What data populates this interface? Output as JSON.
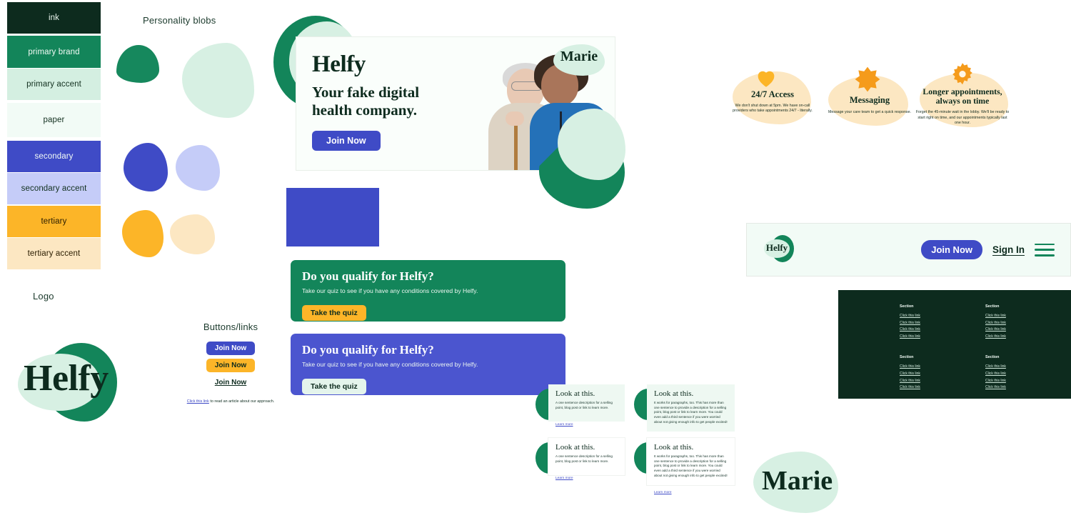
{
  "palette": {
    "ink": {
      "label": "ink",
      "hex": "#0D2B1E"
    },
    "primary_brand": {
      "label": "primary brand",
      "hex": "#13855A"
    },
    "primary_accent": {
      "label": "primary accent",
      "hex": "#D4EFE1"
    },
    "paper": {
      "label": "paper",
      "hex": "#F2FBF6"
    },
    "secondary": {
      "label": "secondary",
      "hex": "#3F4BC6"
    },
    "secondary_accent": {
      "label": "secondary accent",
      "hex": "#C5CCF8"
    },
    "tertiary": {
      "label": "tertiary",
      "hex": "#FCB528"
    },
    "tertiary_accent": {
      "label": "tertiary accent",
      "hex": "#FCE7C2"
    }
  },
  "labels": {
    "blobs": "Personality blobs",
    "logo": "Logo",
    "buttons": "Buttons/links"
  },
  "logo": {
    "wordmark": "Helfy"
  },
  "buttons_links": {
    "primary": "Join Now",
    "secondary": "Join Now",
    "text": "Join Now",
    "inline_link_anchor": "Click this link",
    "inline_link_rest": " to read an article about our approach."
  },
  "hero": {
    "brand": "Helfy",
    "headline": "Your fake digital health company.",
    "cta": "Join Now",
    "name_badge": "Marie"
  },
  "quiz_cards": [
    {
      "title": "Do you qualify for Helfy?",
      "body": "Take our quiz to see if you have any conditions covered by Helfy.",
      "cta": "Take the quiz",
      "theme": "green"
    },
    {
      "title": "Do you qualify for Helfy?",
      "body": "Take our quiz to see if you have any conditions covered by Helfy.",
      "cta": "Take the quiz",
      "theme": "blue"
    }
  ],
  "features": [
    {
      "icon": "heart-icon",
      "title": "24/7 Access",
      "desc": "We don't shut down at 5pm. We have on-call providers who take appointments 24/7 - literally."
    },
    {
      "icon": "message-burst-icon",
      "title": "Messaging",
      "desc": "Message your care team to get a quick response."
    },
    {
      "icon": "gear-icon",
      "title": "Longer appointments, always on time",
      "desc": "Forget the 45-minute wait in the lobby. We'll be ready to start right on time, and our appointments typically last one hour."
    }
  ],
  "navbar": {
    "logo": "Helfy",
    "join": "Join Now",
    "signin": "Sign In",
    "menu_icon": "hamburger-menu-icon"
  },
  "footer": {
    "columns": [
      {
        "heading": "Section",
        "links": [
          "Click this link",
          "Click this link",
          "Click this link",
          "Click this link"
        ]
      },
      {
        "heading": "Section",
        "links": [
          "Click this link",
          "Click this link",
          "Click this link",
          "Click this link"
        ]
      },
      {
        "heading": "Section",
        "links": [
          "Click this link",
          "Click this link",
          "Click this link",
          "Click this link"
        ]
      },
      {
        "heading": "Section",
        "links": [
          "Click this link",
          "Click this link",
          "Click this link",
          "Click this link"
        ]
      }
    ]
  },
  "content_cards": [
    {
      "title": "Look at this.",
      "body": "A one sentence description for a selling point, blog post or link to learn more.",
      "link": "Learn more",
      "bg": "mint"
    },
    {
      "title": "Look at this.",
      "body": "It works for paragraphs, too. This has more than one sentence to provide a description for a selling point, blog post or link to learn more. You could even add a third sentence if you were worried about not giving enough info to get people excited!",
      "link": "Learn more",
      "bg": "mint"
    },
    {
      "title": "Look at this.",
      "body": "A one sentence description for a selling point, blog post or link to learn more.",
      "link": "Learn more",
      "bg": "white"
    },
    {
      "title": "Look at this.",
      "body": "It works for paragraphs, too. This has more than one sentence to provide a description for a selling point, blog post or link to learn more. You could even add a third sentence if you were worried about not giving enough info to get people excited!",
      "link": "Learn more",
      "bg": "white"
    }
  ],
  "name_blob": {
    "text": "Marie"
  }
}
